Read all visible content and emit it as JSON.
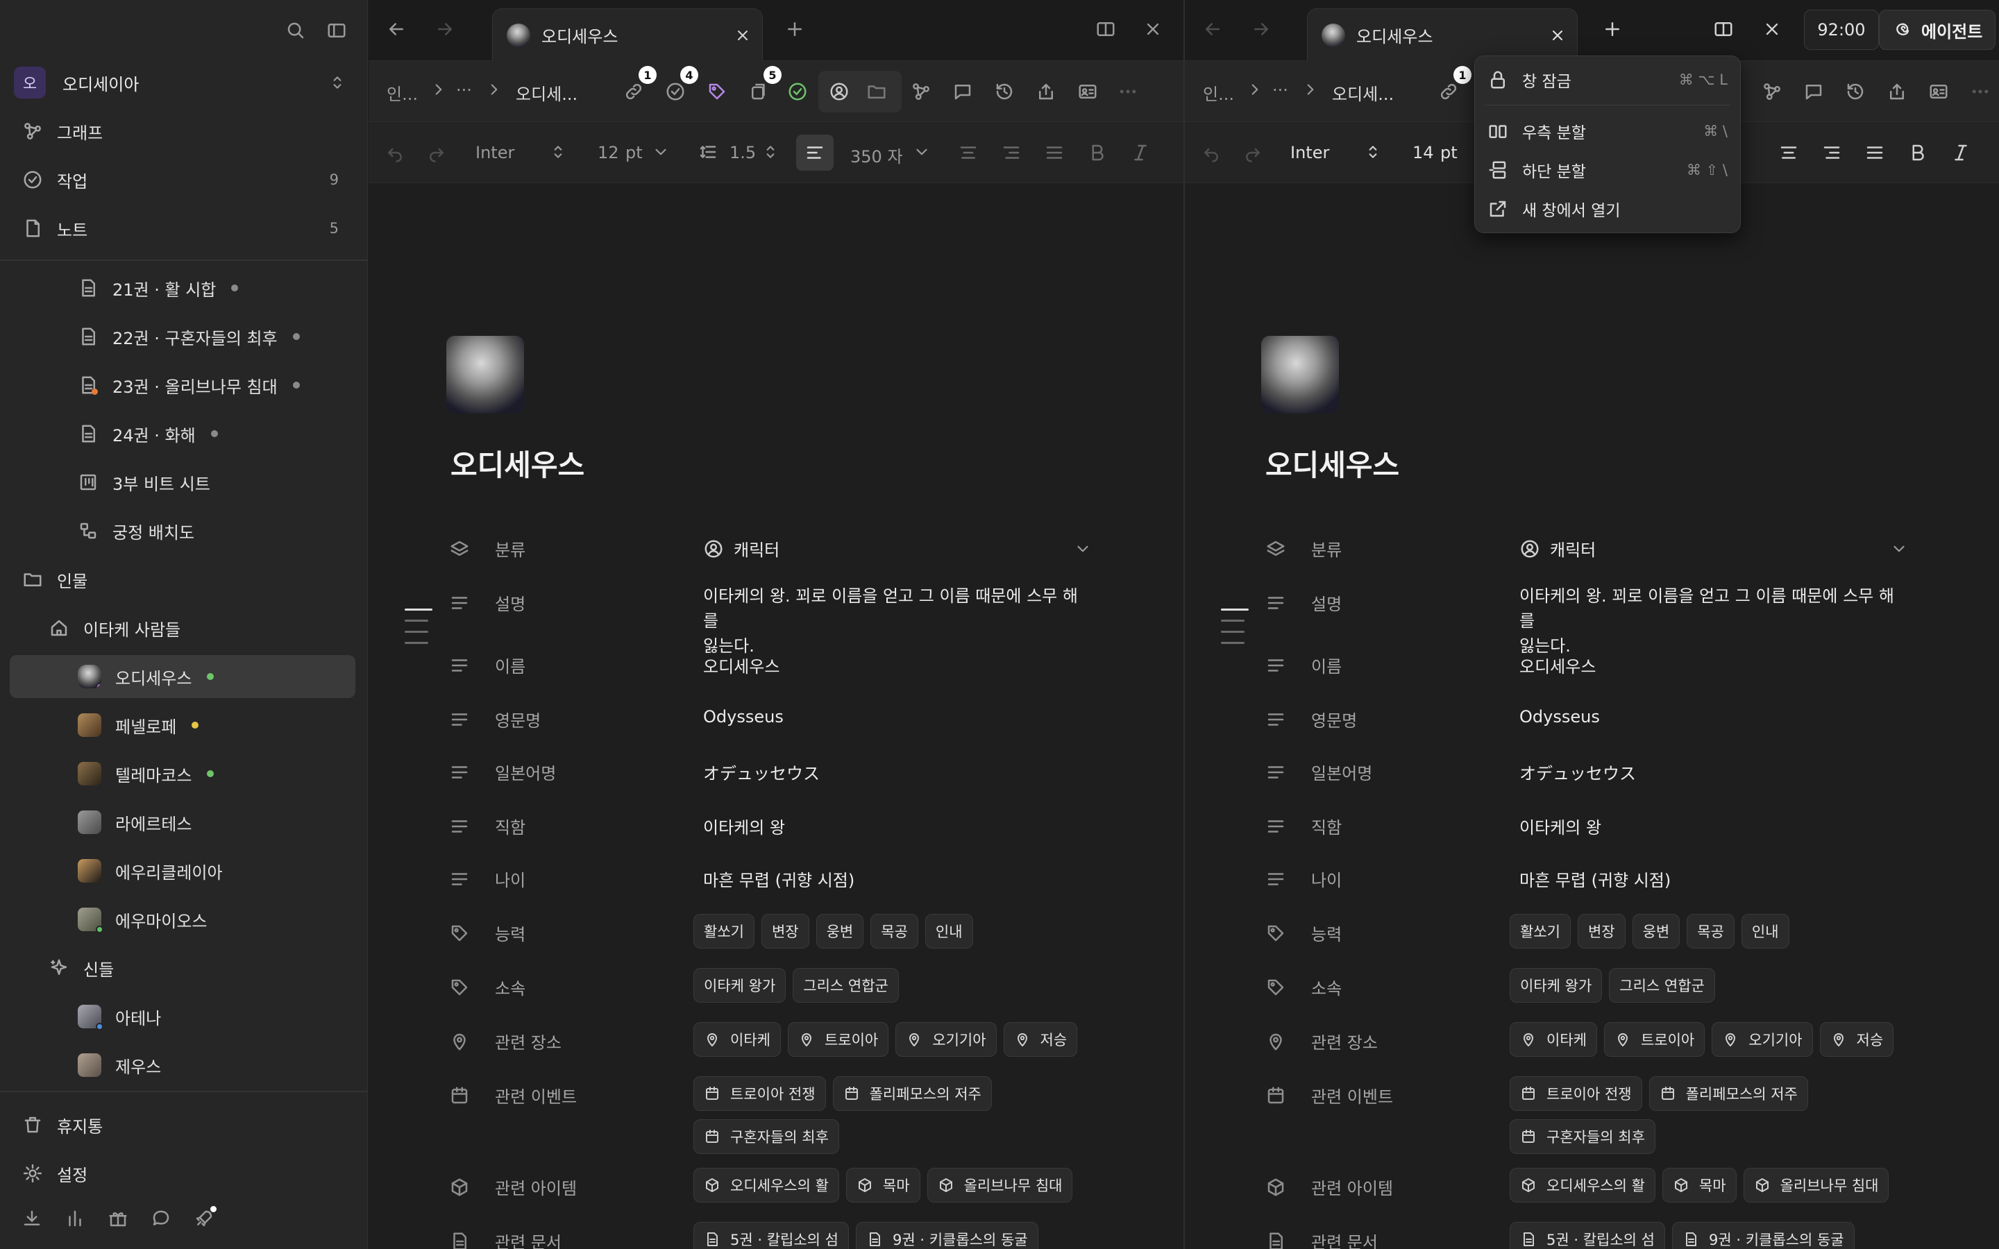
{
  "sidebar": {
    "workspace_initial": "오",
    "workspace_name": "오디세이아",
    "nav": [
      {
        "label": "그래프",
        "icon": "graph-icon",
        "count": ""
      },
      {
        "label": "작업",
        "icon": "check-circle-icon",
        "count": "9"
      },
      {
        "label": "노트",
        "icon": "note-icon",
        "count": "5"
      }
    ],
    "docs": [
      {
        "label": "21권 · 활 시합",
        "icon": "document-icon",
        "dot": "#8a8a8a"
      },
      {
        "label": "22권 · 구혼자들의 최후",
        "icon": "document-icon",
        "dot": "#8a8a8a"
      },
      {
        "label": "23권 · 올리브나무 침대",
        "icon": "document-icon",
        "dot": "#8a8a8a"
      },
      {
        "label": "24권 · 화해",
        "icon": "document-icon",
        "dot": "#8a8a8a"
      },
      {
        "label": "3부 비트 시트",
        "icon": "board-icon",
        "dot": ""
      },
      {
        "label": "궁정 배치도",
        "icon": "diagram-icon",
        "dot": ""
      }
    ],
    "folder_people": "인물",
    "folder_ithaca": "이타케 사람들",
    "people": [
      {
        "label": "오디세우스",
        "dot": "#6fc46a",
        "selected": true
      },
      {
        "label": "페넬로페",
        "dot": "#e6c445",
        "selected": false
      },
      {
        "label": "텔레마코스",
        "dot": "#6fc46a",
        "selected": false
      },
      {
        "label": "라에르테스",
        "dot": "",
        "selected": false
      },
      {
        "label": "에우리클레이아",
        "dot": "",
        "selected": false
      },
      {
        "label": "에우마이오스",
        "dot": "",
        "selected": false
      }
    ],
    "folder_gods": "신들",
    "gods": [
      {
        "label": "아테나"
      },
      {
        "label": "제우스"
      }
    ],
    "trash": "휴지통",
    "settings": "설정"
  },
  "left_pane": {
    "tab_title": "오디세우스",
    "breadcrumb": [
      "인...",
      "···",
      "오디세..."
    ],
    "badges": {
      "links": "1",
      "tasks": "4",
      "tags": "5"
    },
    "font": "Inter",
    "font_size": "12",
    "size_unit": "pt",
    "line_height": "1.5",
    "width": "350 자"
  },
  "right_pane": {
    "tab_title": "오디세우스",
    "breadcrumb": [
      "인...",
      "···",
      "오디세..."
    ],
    "badges": {
      "links": "1"
    },
    "font": "Inter",
    "font_size": "14",
    "size_unit": "pt",
    "time": "92:00",
    "agent_label": "에이전트"
  },
  "doc": {
    "title": "오디세우스",
    "labels": {
      "category": "분류",
      "description": "설명",
      "name": "이름",
      "english_name": "영문명",
      "japanese_name": "일본어명",
      "title": "직함",
      "age": "나이",
      "abilities": "능력",
      "affiliation": "소속",
      "places": "관련 장소",
      "events": "관련 이벤트",
      "items": "관련 아이템",
      "documents": "관련 문서"
    },
    "values": {
      "category": "캐릭터",
      "description_line1": "이타케의 왕. 꾀로 이름을 얻고 그 이름 때문에 스무 해를",
      "description_line2": "잃는다.",
      "name": "오디세우스",
      "english_name": "Odysseus",
      "japanese_name": "オデュッセウス",
      "title": "이타케의 왕",
      "age": "마흔 무렵 (귀향 시점)"
    },
    "abilities": [
      "활쏘기",
      "변장",
      "웅변",
      "목공",
      "인내"
    ],
    "affiliation": [
      "이타케 왕가",
      "그리스 연합군"
    ],
    "places": [
      "이타케",
      "트로이아",
      "오기기아",
      "저승"
    ],
    "events": [
      "트로이아 전쟁",
      "폴리페모스의 저주",
      "구혼자들의 최후"
    ],
    "items": [
      "오디세우스의 활",
      "목마",
      "올리브나무 침대"
    ],
    "documents": [
      "5권 · 칼립소의 섬",
      "9권 · 키클롭스의 동굴"
    ]
  },
  "dropdown_menu": [
    {
      "label": "창 잠금",
      "shortcut": "⌘ ⌥ L",
      "icon": "lock-icon"
    },
    {
      "label": "우측 분할",
      "shortcut": "⌘ \\",
      "icon": "split-right-icon"
    },
    {
      "label": "하단 분할",
      "shortcut": "⌘ ⇧ \\",
      "icon": "split-down-icon"
    },
    {
      "label": "새 창에서 열기",
      "shortcut": "",
      "icon": "external-link-icon"
    }
  ]
}
